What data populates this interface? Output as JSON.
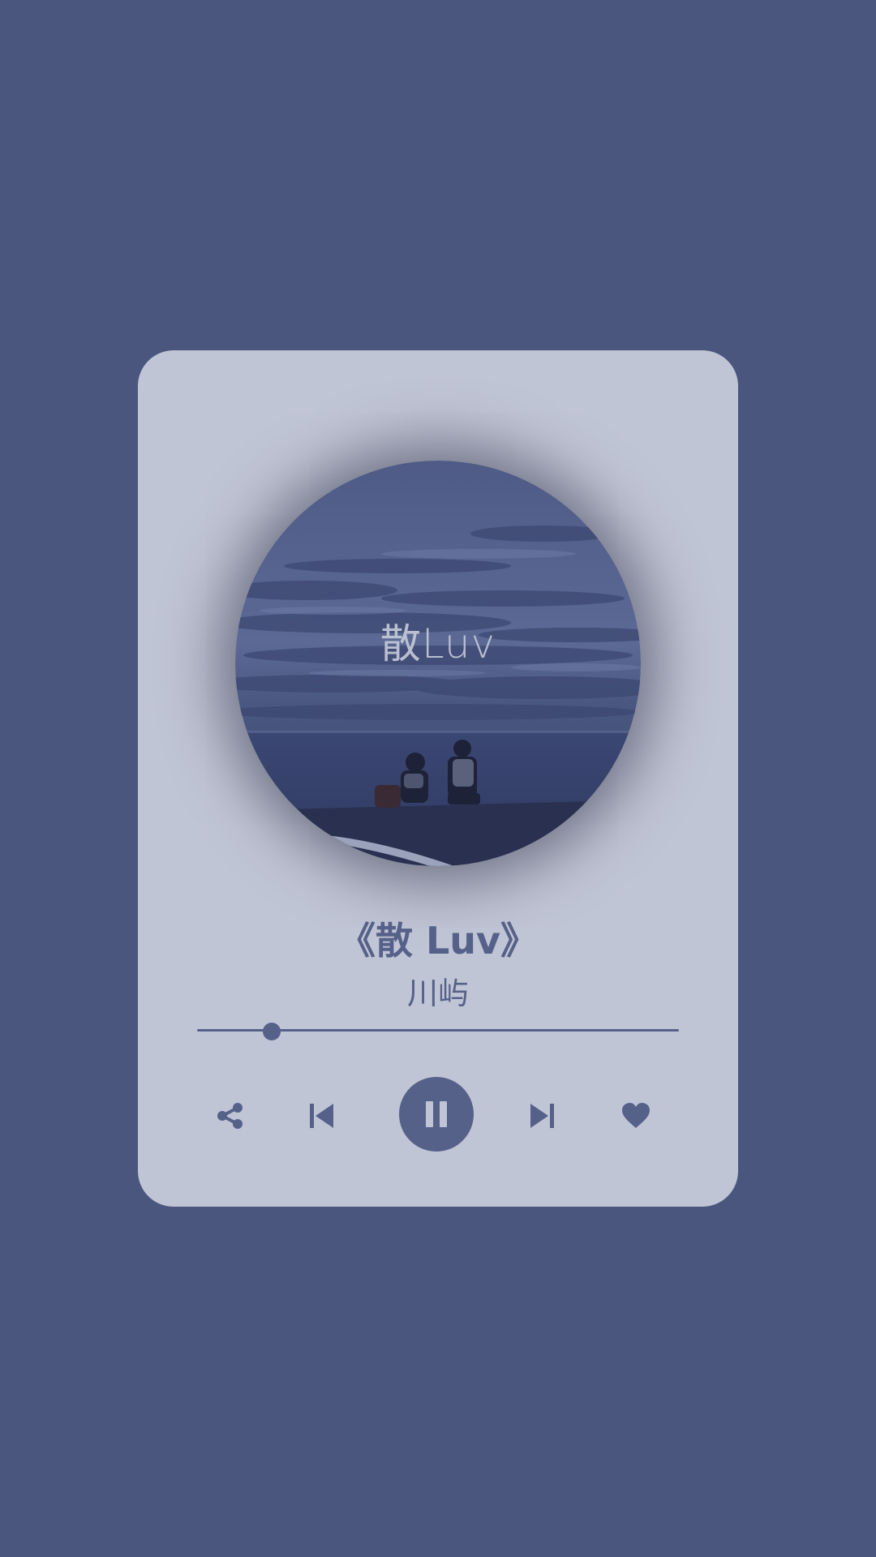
{
  "player": {
    "cover": {
      "title_text": "散Luv"
    },
    "song_title": "《散 Luv》",
    "artist": "川屿",
    "progress": 0.155,
    "controls": {
      "share": "share-icon",
      "previous": "skip-previous-icon",
      "play_pause": "pause-icon",
      "next": "skip-next-icon",
      "like": "heart-icon"
    }
  },
  "colors": {
    "background": "#4a567e",
    "card": "#c0c5d5",
    "accent": "#56618a"
  }
}
